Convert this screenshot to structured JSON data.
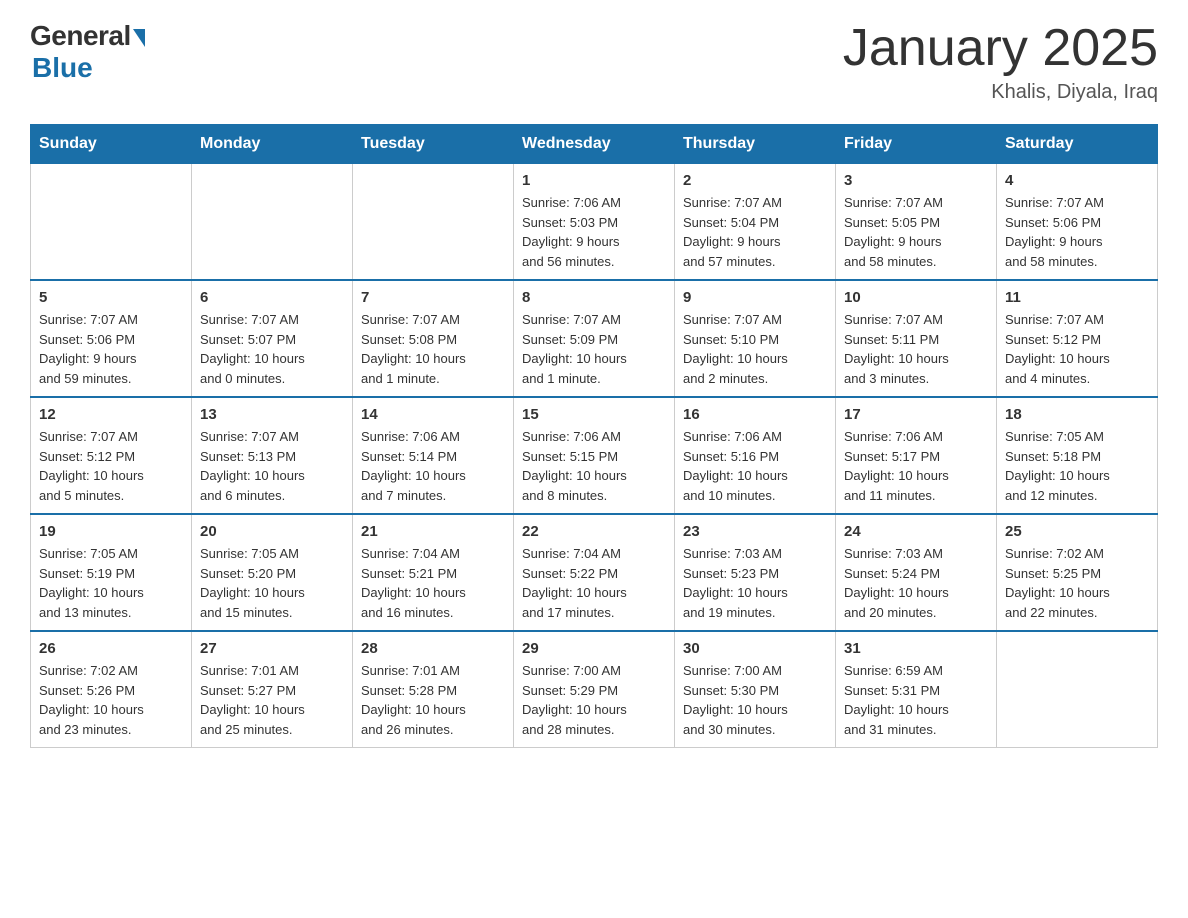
{
  "header": {
    "logo_general": "General",
    "logo_blue": "Blue",
    "month_title": "January 2025",
    "location": "Khalis, Diyala, Iraq"
  },
  "weekdays": [
    "Sunday",
    "Monday",
    "Tuesday",
    "Wednesday",
    "Thursday",
    "Friday",
    "Saturday"
  ],
  "weeks": [
    [
      {
        "day": "",
        "info": ""
      },
      {
        "day": "",
        "info": ""
      },
      {
        "day": "",
        "info": ""
      },
      {
        "day": "1",
        "info": "Sunrise: 7:06 AM\nSunset: 5:03 PM\nDaylight: 9 hours\nand 56 minutes."
      },
      {
        "day": "2",
        "info": "Sunrise: 7:07 AM\nSunset: 5:04 PM\nDaylight: 9 hours\nand 57 minutes."
      },
      {
        "day": "3",
        "info": "Sunrise: 7:07 AM\nSunset: 5:05 PM\nDaylight: 9 hours\nand 58 minutes."
      },
      {
        "day": "4",
        "info": "Sunrise: 7:07 AM\nSunset: 5:06 PM\nDaylight: 9 hours\nand 58 minutes."
      }
    ],
    [
      {
        "day": "5",
        "info": "Sunrise: 7:07 AM\nSunset: 5:06 PM\nDaylight: 9 hours\nand 59 minutes."
      },
      {
        "day": "6",
        "info": "Sunrise: 7:07 AM\nSunset: 5:07 PM\nDaylight: 10 hours\nand 0 minutes."
      },
      {
        "day": "7",
        "info": "Sunrise: 7:07 AM\nSunset: 5:08 PM\nDaylight: 10 hours\nand 1 minute."
      },
      {
        "day": "8",
        "info": "Sunrise: 7:07 AM\nSunset: 5:09 PM\nDaylight: 10 hours\nand 1 minute."
      },
      {
        "day": "9",
        "info": "Sunrise: 7:07 AM\nSunset: 5:10 PM\nDaylight: 10 hours\nand 2 minutes."
      },
      {
        "day": "10",
        "info": "Sunrise: 7:07 AM\nSunset: 5:11 PM\nDaylight: 10 hours\nand 3 minutes."
      },
      {
        "day": "11",
        "info": "Sunrise: 7:07 AM\nSunset: 5:12 PM\nDaylight: 10 hours\nand 4 minutes."
      }
    ],
    [
      {
        "day": "12",
        "info": "Sunrise: 7:07 AM\nSunset: 5:12 PM\nDaylight: 10 hours\nand 5 minutes."
      },
      {
        "day": "13",
        "info": "Sunrise: 7:07 AM\nSunset: 5:13 PM\nDaylight: 10 hours\nand 6 minutes."
      },
      {
        "day": "14",
        "info": "Sunrise: 7:06 AM\nSunset: 5:14 PM\nDaylight: 10 hours\nand 7 minutes."
      },
      {
        "day": "15",
        "info": "Sunrise: 7:06 AM\nSunset: 5:15 PM\nDaylight: 10 hours\nand 8 minutes."
      },
      {
        "day": "16",
        "info": "Sunrise: 7:06 AM\nSunset: 5:16 PM\nDaylight: 10 hours\nand 10 minutes."
      },
      {
        "day": "17",
        "info": "Sunrise: 7:06 AM\nSunset: 5:17 PM\nDaylight: 10 hours\nand 11 minutes."
      },
      {
        "day": "18",
        "info": "Sunrise: 7:05 AM\nSunset: 5:18 PM\nDaylight: 10 hours\nand 12 minutes."
      }
    ],
    [
      {
        "day": "19",
        "info": "Sunrise: 7:05 AM\nSunset: 5:19 PM\nDaylight: 10 hours\nand 13 minutes."
      },
      {
        "day": "20",
        "info": "Sunrise: 7:05 AM\nSunset: 5:20 PM\nDaylight: 10 hours\nand 15 minutes."
      },
      {
        "day": "21",
        "info": "Sunrise: 7:04 AM\nSunset: 5:21 PM\nDaylight: 10 hours\nand 16 minutes."
      },
      {
        "day": "22",
        "info": "Sunrise: 7:04 AM\nSunset: 5:22 PM\nDaylight: 10 hours\nand 17 minutes."
      },
      {
        "day": "23",
        "info": "Sunrise: 7:03 AM\nSunset: 5:23 PM\nDaylight: 10 hours\nand 19 minutes."
      },
      {
        "day": "24",
        "info": "Sunrise: 7:03 AM\nSunset: 5:24 PM\nDaylight: 10 hours\nand 20 minutes."
      },
      {
        "day": "25",
        "info": "Sunrise: 7:02 AM\nSunset: 5:25 PM\nDaylight: 10 hours\nand 22 minutes."
      }
    ],
    [
      {
        "day": "26",
        "info": "Sunrise: 7:02 AM\nSunset: 5:26 PM\nDaylight: 10 hours\nand 23 minutes."
      },
      {
        "day": "27",
        "info": "Sunrise: 7:01 AM\nSunset: 5:27 PM\nDaylight: 10 hours\nand 25 minutes."
      },
      {
        "day": "28",
        "info": "Sunrise: 7:01 AM\nSunset: 5:28 PM\nDaylight: 10 hours\nand 26 minutes."
      },
      {
        "day": "29",
        "info": "Sunrise: 7:00 AM\nSunset: 5:29 PM\nDaylight: 10 hours\nand 28 minutes."
      },
      {
        "day": "30",
        "info": "Sunrise: 7:00 AM\nSunset: 5:30 PM\nDaylight: 10 hours\nand 30 minutes."
      },
      {
        "day": "31",
        "info": "Sunrise: 6:59 AM\nSunset: 5:31 PM\nDaylight: 10 hours\nand 31 minutes."
      },
      {
        "day": "",
        "info": ""
      }
    ]
  ]
}
